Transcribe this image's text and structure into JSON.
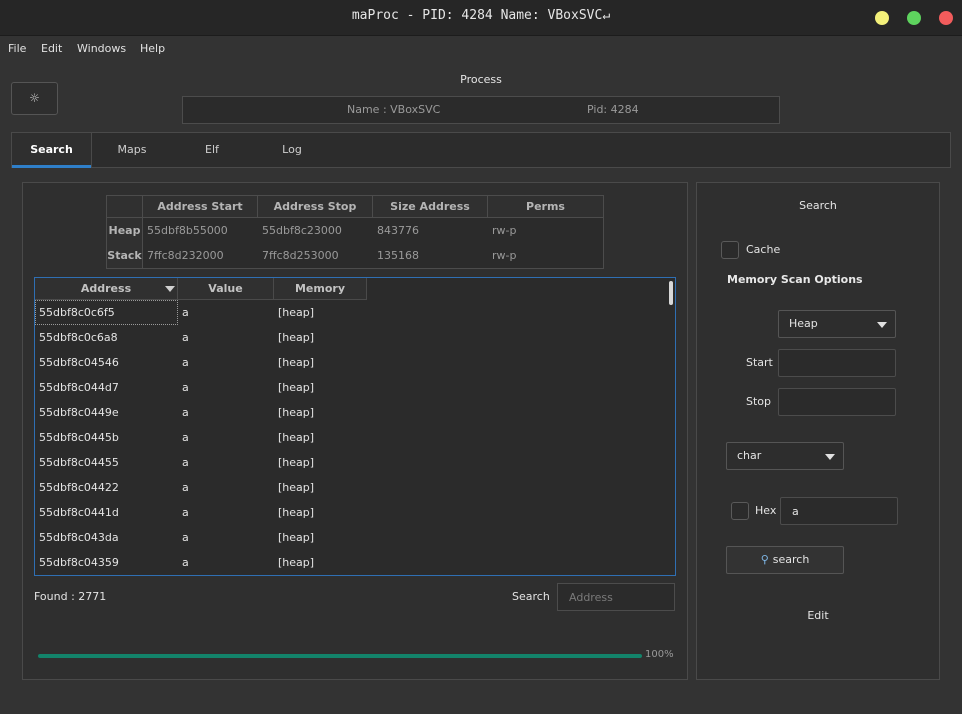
{
  "window": {
    "title": "maProc - PID: 4284 Name: VBoxSVC↵",
    "buttons": {
      "minimize_color": "#f3f07a",
      "maximize_color": "#5ed35e",
      "close_color": "#f25c5c"
    }
  },
  "menubar": {
    "items": [
      "File",
      "Edit",
      "Windows",
      "Help"
    ]
  },
  "toolbar": {
    "settings_icon": "☼"
  },
  "process": {
    "title": "Process",
    "name": "Name : VBoxSVC",
    "pid": "Pid: 4284"
  },
  "tabs": [
    "Search",
    "Maps",
    "Elf",
    "Log"
  ],
  "maps_table": {
    "headers": [
      "Address Start",
      "Address Stop",
      "Size Address",
      "Perms"
    ],
    "rows": [
      {
        "label": "Heap",
        "cells": [
          "55dbf8b55000",
          "55dbf8c23000",
          "843776",
          "rw-p"
        ]
      },
      {
        "label": "Stack",
        "cells": [
          "7ffc8d232000",
          "7ffc8d253000",
          "135168",
          "rw-p"
        ]
      }
    ]
  },
  "results": {
    "headers": [
      "Address",
      "Value",
      "Memory"
    ],
    "rows": [
      [
        "55dbf8c0c6f5",
        "a",
        "[heap]"
      ],
      [
        "55dbf8c0c6a8",
        "a",
        "[heap]"
      ],
      [
        "55dbf8c04546",
        "a",
        "[heap]"
      ],
      [
        "55dbf8c044d7",
        "a",
        "[heap]"
      ],
      [
        "55dbf8c0449e",
        "a",
        "[heap]"
      ],
      [
        "55dbf8c0445b",
        "a",
        "[heap]"
      ],
      [
        "55dbf8c04455",
        "a",
        "[heap]"
      ],
      [
        "55dbf8c04422",
        "a",
        "[heap]"
      ],
      [
        "55dbf8c0441d",
        "a",
        "[heap]"
      ],
      [
        "55dbf8c043da",
        "a",
        "[heap]"
      ],
      [
        "55dbf8c04359",
        "a",
        "[heap]"
      ]
    ],
    "found": "Found : 2771",
    "search_label": "Search",
    "search_placeholder": "Address",
    "progress": {
      "value": 100,
      "text": "100%",
      "color": "#13836a"
    }
  },
  "scan_panel": {
    "title": "Search",
    "cache_label": "Cache",
    "options_title": "Memory Scan Options",
    "region_select": "Heap",
    "start_label": "Start",
    "start_value": "",
    "stop_label": "Stop",
    "stop_value": "",
    "type_select": "char",
    "hex_label": "Hex",
    "query_value": "a",
    "search_button": "search",
    "search_icon": "magnifier-icon",
    "edit_label": "Edit"
  }
}
